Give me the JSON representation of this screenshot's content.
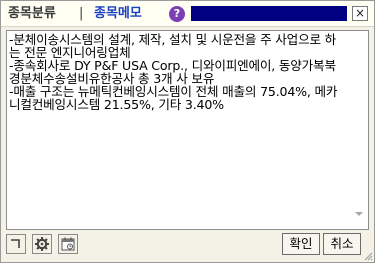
{
  "titlebar": {
    "tab_classification": "종목분류",
    "separator": "|",
    "tab_memo": "종목메모",
    "help_symbol": "?",
    "close_symbol": "×"
  },
  "memo": {
    "text": "-분체이송시스템의 설계, 제작, 설치 및 시운전을 주 사업으로 하는 전문 엔지니어링업체\n-종속회사로 DY P&F USA Corp., 디와이피엔에이, 동양가복북경분체수송설비유한공사 총 3개 사 보유\n-매출 구조는 뉴메틱컨베잉시스템이 전체 매출의 75.04%, 메카니컬컨베잉시스템 21.55%, 기타 3.40%"
  },
  "toolbar": {
    "format_icon": "format-icon",
    "settings_icon": "gear-icon",
    "calendar_icon": "calendar-icon"
  },
  "actions": {
    "confirm_label": "확인",
    "cancel_label": "취소"
  },
  "colors": {
    "window_bg": "#f4f1e6",
    "memo_tab": "#1a3fbf",
    "help_icon": "#7b3fb3",
    "title_fill": "#000080"
  }
}
